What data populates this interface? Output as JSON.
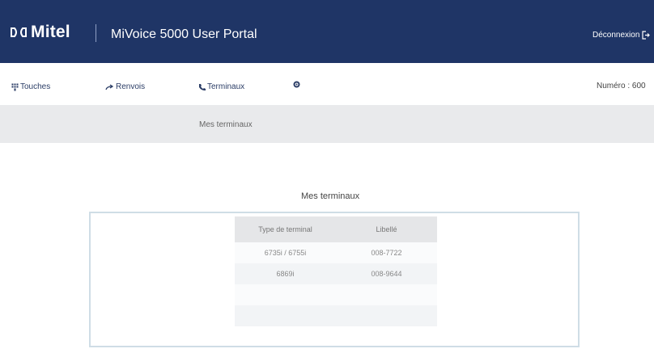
{
  "app": {
    "brand": "Mitel",
    "title": "MiVoice 5000 User Portal",
    "logout_label": "Déconnexion"
  },
  "nav": {
    "items": [
      {
        "label": "Touches",
        "icon": "keypad-icon"
      },
      {
        "label": "Renvois",
        "icon": "forward-arrow-icon"
      },
      {
        "label": "Terminaux",
        "icon": "phone-icon"
      },
      {
        "label": "",
        "icon": "gear-icon"
      }
    ],
    "numero": "Numéro : 600"
  },
  "subnav": {
    "active_label": "Mes terminaux"
  },
  "main": {
    "section_title": "Mes terminaux",
    "table": {
      "columns": [
        "Type de terminal",
        "Libellé"
      ],
      "rows": [
        [
          "6735i / 6755i",
          "008-7722"
        ],
        [
          "6869i",
          "008-9644"
        ]
      ]
    }
  },
  "colors": {
    "header_bg": "#1f3566",
    "subnav_bg": "#e9eaec",
    "panel_border": "#cfdde6"
  }
}
